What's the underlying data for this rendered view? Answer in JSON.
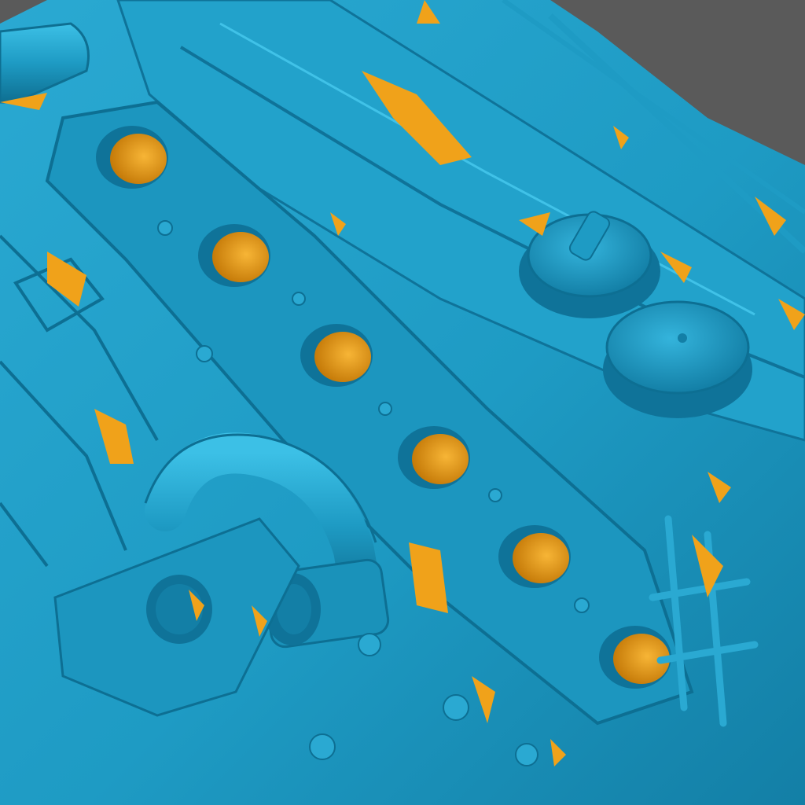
{
  "viewport": {
    "subject": "engine-block-3d-scan",
    "background_color": "#5a5a5a",
    "surface_color": "#1e9bc4",
    "surface_shadow_color": "#0d6f93",
    "surface_highlight_color": "#36b7de",
    "backface_color": "#f0a21a",
    "backface_shadow_color": "#c77d0a"
  }
}
